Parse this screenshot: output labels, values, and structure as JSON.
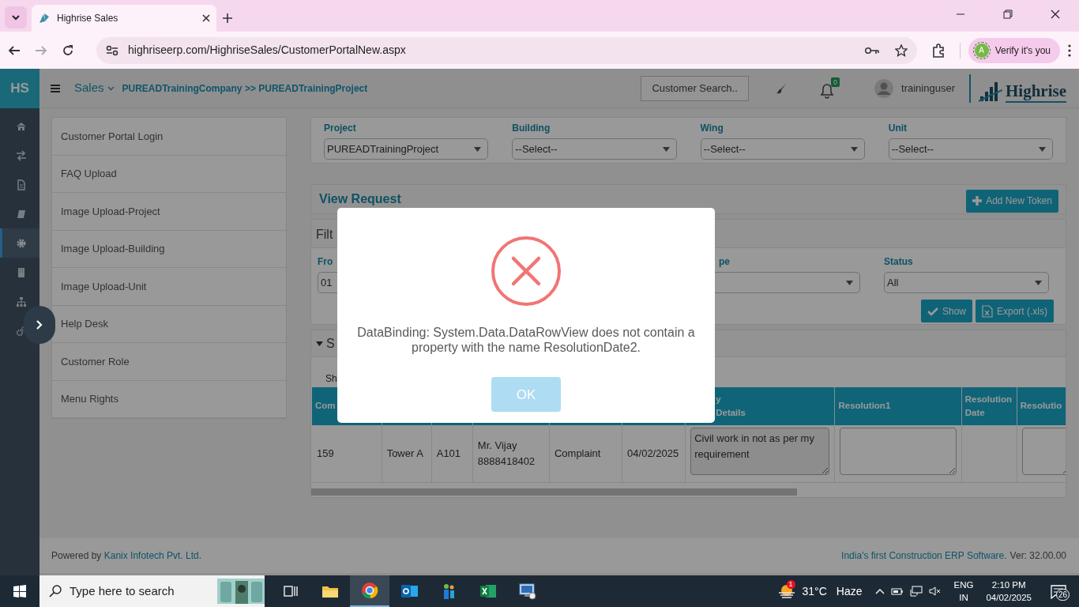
{
  "browser": {
    "tab_title": "Highrise Sales",
    "url": "highriseerp.com/HighriseSales/CustomerPortalNew.aspx",
    "profile_initial": "A",
    "profile_button": "Verify it's you"
  },
  "header": {
    "logo": "HS",
    "module": "Sales",
    "breadcrumb": "PUREADTrainingCompany >> PUREADTrainingProject",
    "search_button": "Customer Search..",
    "notification_count": "0",
    "user": "traininguser",
    "brand": "Highrise"
  },
  "sidebar": {
    "items": [
      {
        "kind": "home",
        "selected": false
      },
      {
        "kind": "exchange",
        "selected": false
      },
      {
        "kind": "file",
        "selected": false
      },
      {
        "kind": "book",
        "selected": false
      },
      {
        "kind": "gear",
        "selected": true
      },
      {
        "kind": "building",
        "selected": false
      },
      {
        "kind": "sitemap",
        "selected": false
      },
      {
        "kind": "cogs",
        "selected": false
      }
    ]
  },
  "menu": [
    {
      "label": "Customer Portal Login"
    },
    {
      "label": "FAQ Upload"
    },
    {
      "label": "Image Upload-Project"
    },
    {
      "label": "Image Upload-Building"
    },
    {
      "label": "Image Upload-Unit"
    },
    {
      "label": "Help Desk"
    },
    {
      "label": "Customer Role"
    },
    {
      "label": "Menu Rights"
    }
  ],
  "location_filters": [
    {
      "label": "Project",
      "value": "PUREADTrainingProject"
    },
    {
      "label": "Building",
      "value": "--Select--"
    },
    {
      "label": "Wing",
      "value": "--Select--"
    },
    {
      "label": "Unit",
      "value": "--Select--"
    }
  ],
  "view_request": {
    "title": "View Request",
    "add_button": "Add New Token",
    "filter_title": "Filt",
    "filters": [
      {
        "label": "Fro",
        "value": "01",
        "kind": "input"
      },
      {
        "label": "pe",
        "kind": "select"
      },
      {
        "label": "Status",
        "value": "All",
        "kind": "select"
      }
    ],
    "show_button": "Show",
    "export_button": "Export (.xls)",
    "section_title": "S",
    "section_expanded": true,
    "entries_label": "Sh"
  },
  "table": {
    "columns": [
      "Com",
      null,
      null,
      null,
      null,
      null,
      "y Details",
      "Resolution1",
      "Resolution Date",
      "Resolutio"
    ],
    "rows": [
      {
        "cells": [
          {
            "kind": "text",
            "text": "159"
          },
          {
            "kind": "text",
            "text": "Tower A"
          },
          {
            "kind": "text",
            "text": "A101"
          },
          {
            "kind": "text",
            "lines": [
              "Mr. Vijay",
              "8888418402"
            ]
          },
          {
            "kind": "text",
            "text": "Complaint"
          },
          {
            "kind": "text",
            "text": "04/02/2025"
          },
          {
            "kind": "textarea",
            "value": "Civil work in not as per my requirement",
            "disabled": true
          },
          {
            "kind": "textarea",
            "disabled": false
          },
          {
            "kind": "blank"
          },
          {
            "kind": "textarea",
            "disabled": false
          }
        ]
      }
    ]
  },
  "footer": {
    "powered_by": "Powered by",
    "company_link": "Kanix Infotech Pvt. Ltd.",
    "tagline": "India's first Construction ERP Software.",
    "version": "Ver: 32.00.00"
  },
  "dialog": {
    "message": "DataBinding: System.Data.DataRowView does not contain a property with the name ResolutionDate2.",
    "button": "OK"
  },
  "taskbar": {
    "search_placeholder": "Type here to search",
    "weather_badge": "1",
    "temperature": "31°C",
    "weather": "Haze",
    "language": "ENG",
    "region": "IN",
    "time": "2:10 PM",
    "date": "04/02/2025",
    "notifications": "26"
  }
}
